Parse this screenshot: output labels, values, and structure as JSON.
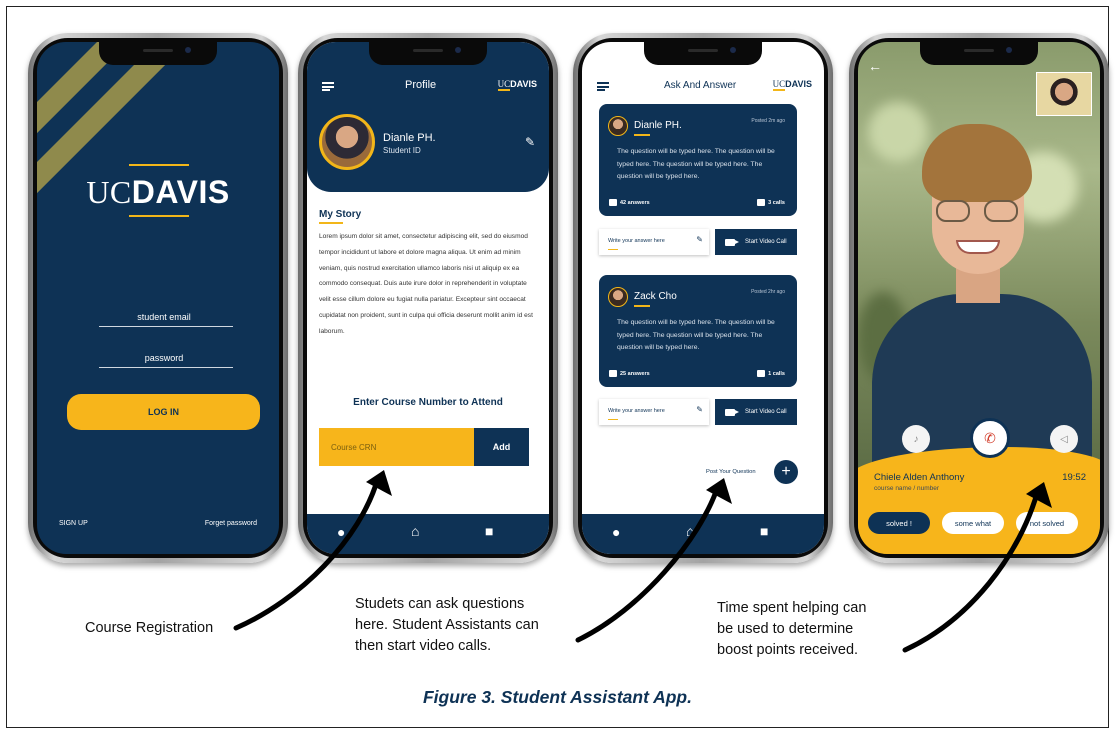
{
  "screen1": {
    "logo_uc": "UC",
    "logo_davis": "DAVIS",
    "email_label": "student email",
    "password_label": "password",
    "login_button": "LOG IN",
    "sign_up": "SIGN UP",
    "forgot_password": "Forget password"
  },
  "screen2": {
    "title": "Profile",
    "logo_uc": "UC",
    "logo_davis": "DAVIS",
    "name": "Dianle PH.",
    "student_id": "Student ID",
    "story_heading": "My Story",
    "story_text": "Lorem ipsum dolor sit amet, consectetur adipiscing elit, sed do eiusmod tempor incididunt ut labore et dolore magna aliqua. Ut enim ad minim veniam, quis nostrud exercitation ullamco laboris nisi ut aliquip ex ea commodo consequat. Duis aute irure dolor in reprehenderit in voluptate velit esse cillum dolore eu fugiat nulla pariatur. Excepteur sint occaecat cupidatat non proident, sunt in culpa qui officia deserunt mollit anim id est laborum.",
    "course_heading": "Enter Course Number to Attend",
    "crn_placeholder": "Course CRN",
    "add_button": "Add"
  },
  "screen3": {
    "title": "Ask And Answer",
    "logo_uc": "UC",
    "logo_davis": "DAVIS",
    "questions": [
      {
        "name": "Dianle PH.",
        "posted": "Posted 2m ago",
        "text": "The question will be typed here. The question will be typed here. The question will be typed here. The question will be typed here.",
        "answers": "42 answers",
        "calls": "3 calls"
      },
      {
        "name": "Zack Cho",
        "posted": "Posted 2hr ago",
        "text": "The question will be typed here. The question will be typed here. The question will be typed here. The question will be typed here.",
        "answers": "25 answers",
        "calls": "1 calls"
      }
    ],
    "answer_placeholder": "Write your answer here",
    "video_call_button": "Start Video Call",
    "post_question": "Post Your Question"
  },
  "screen4": {
    "caller_name": "Chiele Alden Anthony",
    "caller_sub": "course name / number",
    "timer": "19:52",
    "rating_options": [
      "solved !",
      "some what",
      "not solved"
    ]
  },
  "captions": {
    "course_registration": "Course Registration",
    "ask_line1": "Studets can ask questions",
    "ask_line2": "here. Student Assistants can",
    "ask_line3": "then start video calls.",
    "time_line1": "Time spent helping can",
    "time_line2": "be used to determine",
    "time_line3": "boost points received.",
    "figure": "Figure 3. Student Assistant App."
  },
  "colors": {
    "navy": "#0e3255",
    "gold": "#f7b51b"
  }
}
